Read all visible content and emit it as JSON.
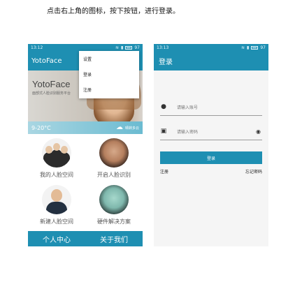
{
  "instruction": "点击右上角的图标，按下按钮，进行登录。",
  "left": {
    "status": {
      "time": "13:12",
      "battery": "97"
    },
    "app_title": "YotoFace",
    "menu": [
      "设置",
      "登录",
      "注册"
    ],
    "banner": {
      "title": "YotoFace",
      "subtitle": "面部式人脸识别服务平台"
    },
    "weather": {
      "temp": "9-20°C",
      "desc": "晴转多云"
    },
    "tiles": [
      {
        "label": "我的人脸空间",
        "icon": "group-avatar-icon"
      },
      {
        "label": "开启人脸识别",
        "icon": "face-scan-icon"
      },
      {
        "label": "新建人脸空间",
        "icon": "businessman-avatar-icon"
      },
      {
        "label": "硬件解决方案",
        "icon": "face-hardware-icon"
      }
    ],
    "bottom_nav": [
      "个人中心",
      "关于我们"
    ]
  },
  "right": {
    "status": {
      "time": "13:13",
      "battery": "97"
    },
    "title": "登录",
    "username_placeholder": "请输入账号",
    "password_placeholder": "请输入密码",
    "login_button": "登录",
    "register_link": "注册",
    "forgot_link": "忘记密码"
  },
  "colors": {
    "primary": "#1e8fb2",
    "background": "#f5f5f5"
  }
}
